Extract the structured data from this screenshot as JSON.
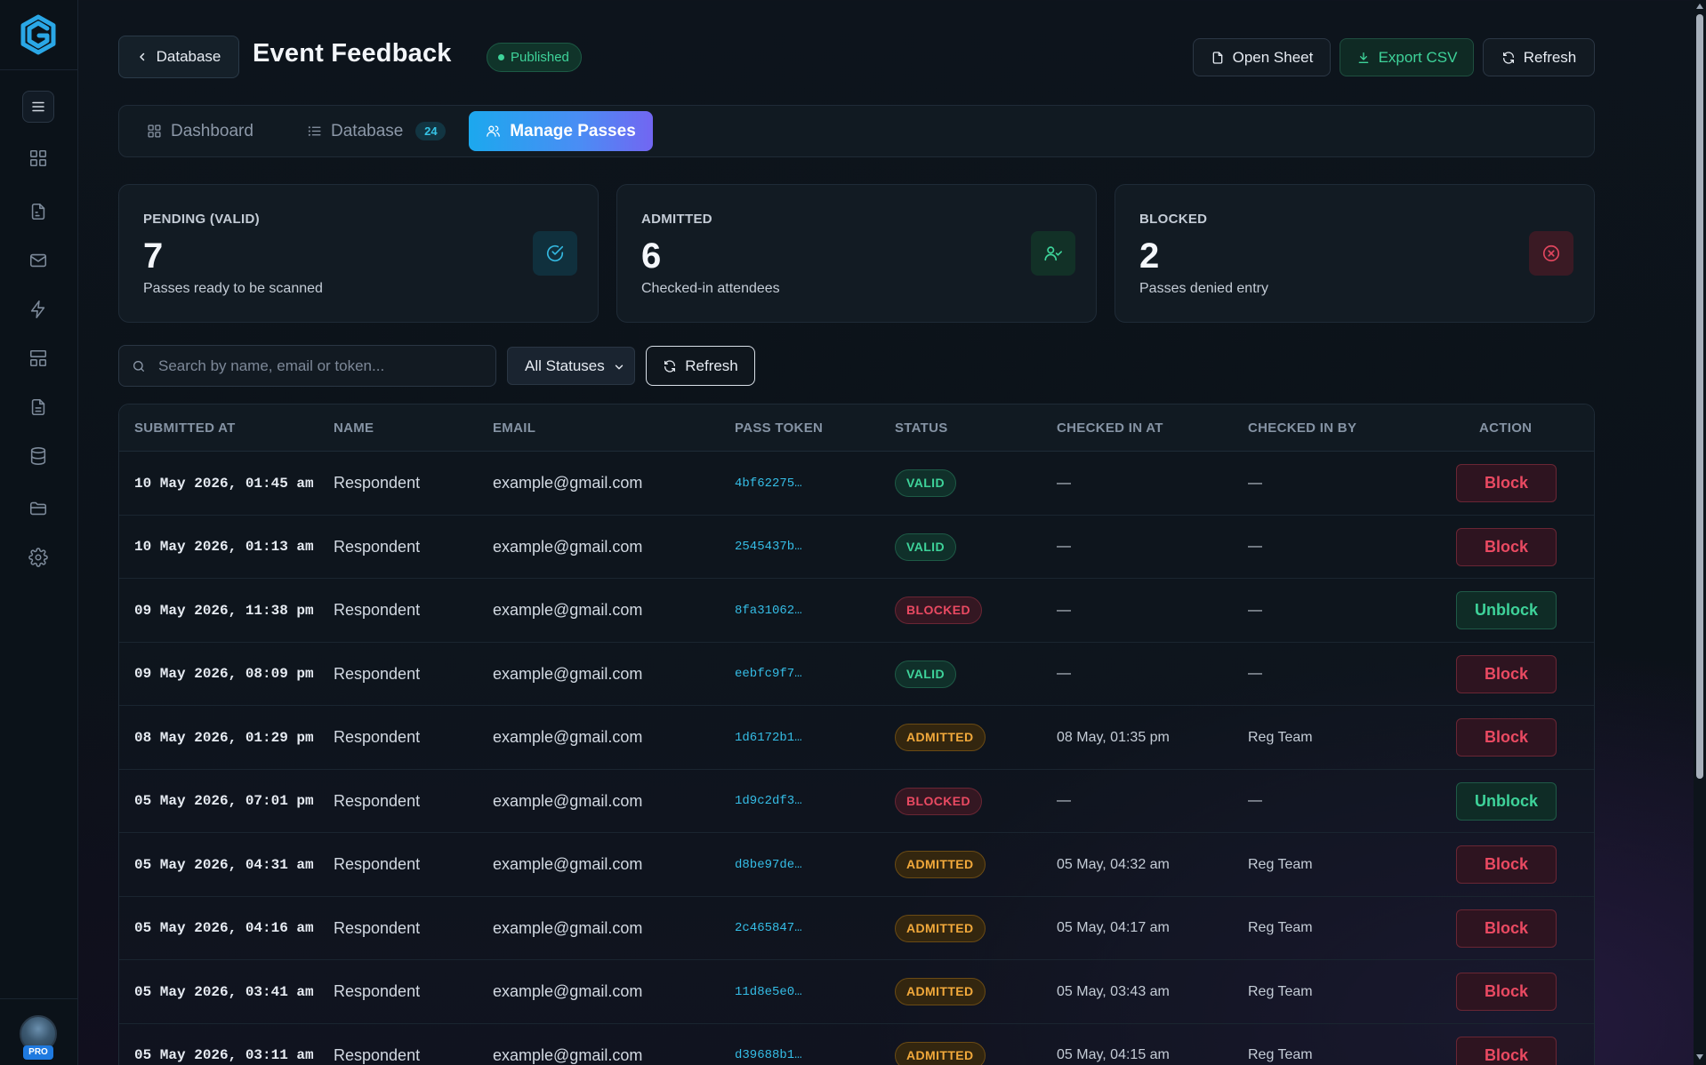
{
  "header": {
    "back_label": "Database",
    "title": "Event Feedback",
    "status_badge": "Published",
    "open_sheet_label": "Open Sheet",
    "export_csv_label": "Export CSV",
    "refresh_label": "Refresh"
  },
  "tabs": [
    {
      "label": "Dashboard",
      "icon": "grid-icon"
    },
    {
      "label": "Database",
      "icon": "list-icon",
      "count": "24"
    },
    {
      "label": "Manage Passes",
      "icon": "users-icon",
      "active": true
    }
  ],
  "stats": [
    {
      "label": "PENDING (VALID)",
      "value": "7",
      "sub": "Passes ready to be scanned",
      "icon": "check-circle-icon",
      "color": "#34b8e0"
    },
    {
      "label": "ADMITTED",
      "value": "6",
      "sub": "Checked-in attendees",
      "icon": "user-check-icon",
      "color": "#3ed39a"
    },
    {
      "label": "BLOCKED",
      "value": "2",
      "sub": "Passes denied entry",
      "icon": "x-circle-icon",
      "color": "#e0465e"
    }
  ],
  "filters": {
    "search_placeholder": "Search by name, email or token...",
    "status_selected": "All Statuses",
    "refresh_label": "Refresh"
  },
  "table": {
    "columns": [
      "SUBMITTED AT",
      "NAME",
      "EMAIL",
      "PASS TOKEN",
      "STATUS",
      "CHECKED IN AT",
      "CHECKED IN BY",
      "ACTION"
    ],
    "rows": [
      {
        "submitted": "10 May 2026, 01:45 am",
        "name": "Respondent",
        "email": "example@gmail.com",
        "token": "4bf62275…",
        "status": "VALID",
        "checked_in_at": "—",
        "checked_in_by": "—",
        "action": "Block"
      },
      {
        "submitted": "10 May 2026, 01:13 am",
        "name": "Respondent",
        "email": "example@gmail.com",
        "token": "2545437b…",
        "status": "VALID",
        "checked_in_at": "—",
        "checked_in_by": "—",
        "action": "Block"
      },
      {
        "submitted": "09 May 2026, 11:38 pm",
        "name": "Respondent",
        "email": "example@gmail.com",
        "token": "8fa31062…",
        "status": "BLOCKED",
        "checked_in_at": "—",
        "checked_in_by": "—",
        "action": "Unblock"
      },
      {
        "submitted": "09 May 2026, 08:09 pm",
        "name": "Respondent",
        "email": "example@gmail.com",
        "token": "eebfc9f7…",
        "status": "VALID",
        "checked_in_at": "—",
        "checked_in_by": "—",
        "action": "Block"
      },
      {
        "submitted": "08 May 2026, 01:29 pm",
        "name": "Respondent",
        "email": "example@gmail.com",
        "token": "1d6172b1…",
        "status": "ADMITTED",
        "checked_in_at": "08 May, 01:35 pm",
        "checked_in_by": "Reg Team",
        "action": "Block"
      },
      {
        "submitted": "05 May 2026, 07:01 pm",
        "name": "Respondent",
        "email": "example@gmail.com",
        "token": "1d9c2df3…",
        "status": "BLOCKED",
        "checked_in_at": "—",
        "checked_in_by": "—",
        "action": "Unblock"
      },
      {
        "submitted": "05 May 2026, 04:31 am",
        "name": "Respondent",
        "email": "example@gmail.com",
        "token": "d8be97de…",
        "status": "ADMITTED",
        "checked_in_at": "05 May, 04:32 am",
        "checked_in_by": "Reg Team",
        "action": "Block"
      },
      {
        "submitted": "05 May 2026, 04:16 am",
        "name": "Respondent",
        "email": "example@gmail.com",
        "token": "2c465847…",
        "status": "ADMITTED",
        "checked_in_at": "05 May, 04:17 am",
        "checked_in_by": "Reg Team",
        "action": "Block"
      },
      {
        "submitted": "05 May 2026, 03:41 am",
        "name": "Respondent",
        "email": "example@gmail.com",
        "token": "11d8e5e0…",
        "status": "ADMITTED",
        "checked_in_at": "05 May, 03:43 am",
        "checked_in_by": "Reg Team",
        "action": "Block"
      },
      {
        "submitted": "05 May 2026, 03:11 am",
        "name": "Respondent",
        "email": "example@gmail.com",
        "token": "d39688b1…",
        "status": "ADMITTED",
        "checked_in_at": "05 May, 04:15 am",
        "checked_in_by": "Reg Team",
        "action": "Block"
      }
    ]
  },
  "sidebar": {
    "items": [
      "menu-icon",
      "dashboard-icon",
      "forms-icon",
      "mail-icon",
      "lightning-icon",
      "layout-icon",
      "document-icon",
      "database-icon",
      "folder-icon",
      "settings-icon"
    ],
    "user_badge": "PRO"
  }
}
